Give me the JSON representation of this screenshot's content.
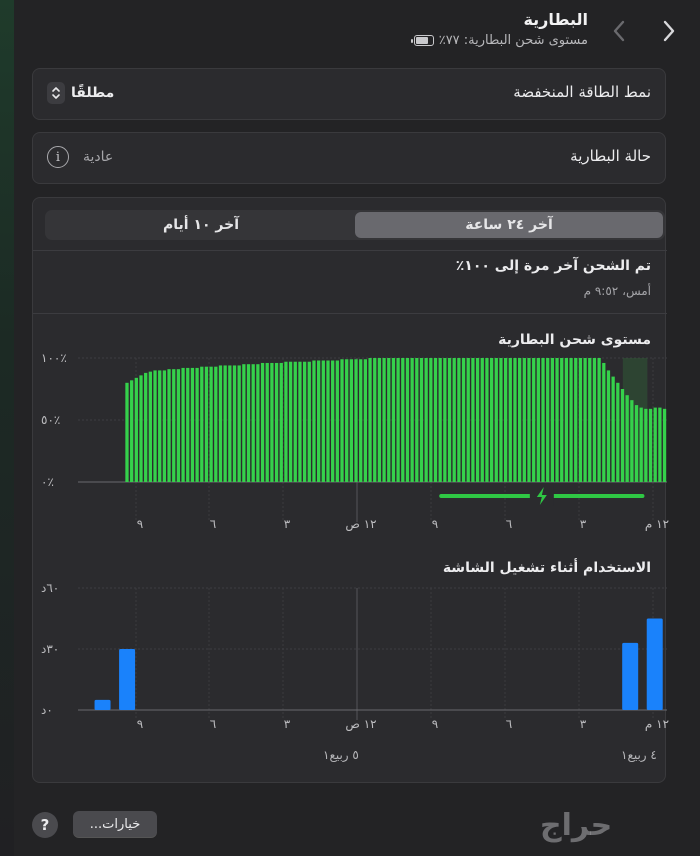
{
  "header": {
    "title": "البطارية",
    "subtitle": "مستوى شحن البطارية: ٧٧٪",
    "back_icon": "chevron-left-icon",
    "forward_icon": "chevron-right-icon"
  },
  "low_power": {
    "label": "نمط الطاقة المنخفضة",
    "value": "مطلقًا"
  },
  "health": {
    "label": "حالة البطارية",
    "value": "عادية",
    "icon": "info-icon"
  },
  "tabs": [
    {
      "label": "آخر ٢٤ ساعة",
      "active": true
    },
    {
      "label": "آخر ١٠ أيام",
      "active": false
    }
  ],
  "last_charge": {
    "title": "تم الشحن آخر مرة إلى ١٠٠٪",
    "time": "أمس، ٩:٥٢ م"
  },
  "time_ticks": [
    "٩",
    "٦",
    "٣",
    "١٢ ص",
    "٩",
    "٦",
    "٣",
    "١٢ م"
  ],
  "chart_data": [
    {
      "type": "bar",
      "title": "مستوى شحن البطارية",
      "unit": "%",
      "y_ticks": [
        "١٠٠٪",
        "٥٠٪",
        "٠٪"
      ],
      "ylim": [
        0,
        100
      ],
      "grid": true,
      "color": "#35d14b",
      "charging_color": "#2fc744",
      "charging_icon": "bolt-icon",
      "hours_back_range": [
        24,
        0
      ],
      "values": [
        0,
        0,
        0,
        0,
        0,
        0,
        0,
        0,
        0,
        0,
        80,
        82,
        84,
        86,
        88,
        89,
        90,
        90,
        90,
        91,
        91,
        91,
        92,
        92,
        92,
        92,
        93,
        93,
        93,
        93,
        94,
        94,
        94,
        94,
        94,
        95,
        95,
        95,
        95,
        96,
        96,
        96,
        96,
        96,
        97,
        97,
        97,
        97,
        97,
        97,
        98,
        98,
        98,
        98,
        98,
        98,
        99,
        99,
        99,
        99,
        99,
        99,
        100,
        100,
        100,
        100,
        100,
        100,
        100,
        100,
        100,
        100,
        100,
        100,
        100,
        100,
        100,
        100,
        100,
        100,
        100,
        100,
        100,
        100,
        100,
        100,
        100,
        100,
        100,
        100,
        100,
        100,
        100,
        100,
        100,
        100,
        100,
        100,
        100,
        100,
        100,
        100,
        100,
        100,
        100,
        100,
        100,
        100,
        100,
        100,
        100,
        100,
        96,
        90,
        85,
        80,
        75,
        70,
        66,
        62,
        60,
        59,
        59,
        60,
        60,
        59
      ],
      "charging_hours_back": [
        9.2,
        1.0
      ],
      "plugged_shade_hours_back": [
        1.8,
        0.8
      ]
    },
    {
      "type": "bar",
      "title": "الاستخدام أثناء تشغيل الشاشة",
      "unit": "min",
      "y_ticks": [
        "٦٠د",
        "٣٠د",
        "٠د"
      ],
      "ylim": [
        0,
        60
      ],
      "grid": true,
      "color": "#1a82fb",
      "categories_hours_back": [
        23,
        22,
        1.5,
        0.5
      ],
      "values": [
        5,
        30,
        33,
        45
      ]
    }
  ],
  "dates": [
    "٥ ربيع١",
    "٤ ربيع١"
  ],
  "footer": {
    "options_label": "خيارات...",
    "help_label": "?"
  },
  "watermark": "حراج"
}
